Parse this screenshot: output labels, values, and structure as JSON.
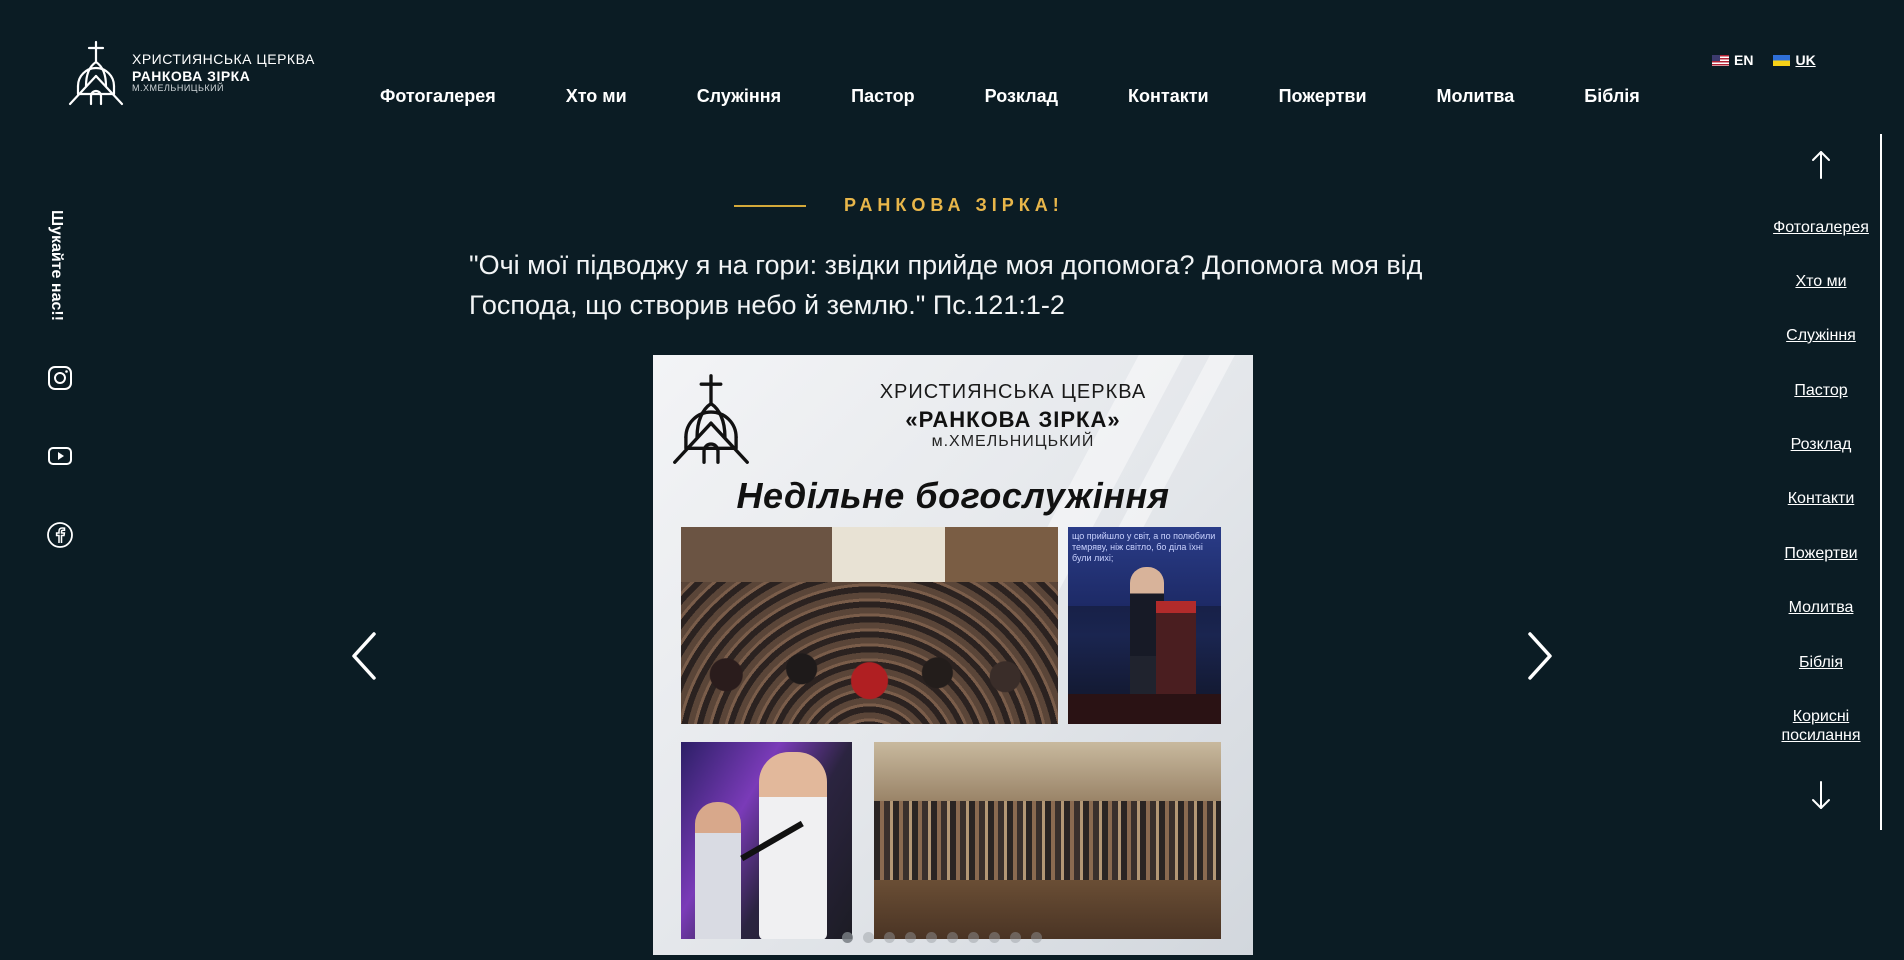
{
  "logo": {
    "line1": "ХРИСТИЯНСЬКА ЦЕРКВА",
    "line2": "РАНКОВА ЗІРКА",
    "line3": "М.ХМЕЛЬНИЦЬКИЙ"
  },
  "nav": [
    "Фотогалерея",
    "Хто ми",
    "Служіння",
    "Пастор",
    "Розклад",
    "Контакти",
    "Пожертви",
    "Молитва",
    "Біблія"
  ],
  "lang": {
    "en": "EN",
    "uk": "UK"
  },
  "social": {
    "label": "Шукайте нас!!",
    "icons": [
      "instagram-icon",
      "youtube-icon",
      "facebook-icon"
    ]
  },
  "hero": {
    "heading": "РАНКОВА ЗІРКА!",
    "quote": "\"Очі мої підводжу я на гори: звідки прийде моя допомога? Допомога моя від Господа, що створив небо й землю.\" Пс.121:1-2"
  },
  "slide": {
    "title1": "ХРИСТИЯНСЬКА ЦЕРКВА",
    "title2": "«РАНКОВА ЗІРКА»",
    "title3": "м.ХМЕЛЬНИЦЬКИЙ",
    "headline": "Недільне богослужіння",
    "screen_text": "що прийшло у світ, а по полюбили темряву, ніж світло, бо діла їхні були лихі;"
  },
  "slider": {
    "dot_count": 10,
    "active_dot": 0
  },
  "sidenav": [
    "Фотогалерея",
    "Хто ми",
    "Служіння",
    "Пастор",
    "Розклад",
    "Контакти",
    "Пожертви",
    "Молитва",
    "Біблія",
    "Корисні посилання"
  ],
  "colors": {
    "background": "#0b1c24",
    "accent": "#e8b64a",
    "text": "#ffffff"
  }
}
